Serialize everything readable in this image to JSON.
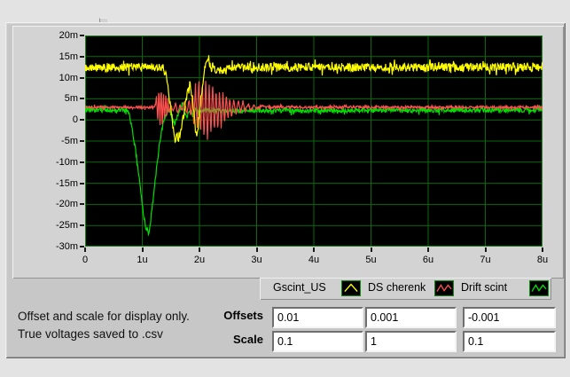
{
  "window": {
    "bg": "#e3e3e3",
    "panel_bg": "#c7c7c7",
    "graph_panel_bg": "#d3d3d3"
  },
  "info_text": {
    "line1": "Offset and scale for display only.",
    "line2": "True voltages saved to .csv"
  },
  "controls": {
    "offsets_label": "Offsets",
    "scale_label": "Scale",
    "offsets": [
      "0.01",
      "0.001",
      "-0.001"
    ],
    "scale": [
      "0.1",
      "1",
      "0.1"
    ]
  },
  "legend": {
    "items": [
      {
        "label": "Gscint_US",
        "color": "#ffff00",
        "glyph": "caret"
      },
      {
        "label": "DS cherenk",
        "color": "#ff5050",
        "glyph": "zigzag"
      },
      {
        "label": "Drift scint",
        "color": "#00e000",
        "glyph": "zigzag"
      }
    ]
  },
  "chart_data": {
    "type": "line",
    "title": "",
    "xlabel": "",
    "ylabel": "",
    "plot_bg": "#000000",
    "grid_color": "#0a6a0a",
    "border_color": "#0f8a0f",
    "grid": true,
    "legend_position": "bottom-right",
    "x_range_us": [
      0,
      8
    ],
    "y_range_mV": [
      -30,
      20
    ],
    "x_ticks": [
      "0",
      "1u",
      "2u",
      "3u",
      "4u",
      "5u",
      "6u",
      "7u",
      "8u"
    ],
    "y_ticks": [
      "20m",
      "15m",
      "10m",
      "5m",
      "0",
      "-5m",
      "-10m",
      "-15m",
      "-20m",
      "-25m",
      "-30m"
    ],
    "series": [
      {
        "name": "Gscint_US",
        "color": "#ffff00",
        "seed": 7,
        "noise_mV": 1.0,
        "keypoints_us_mV": [
          [
            0,
            12.5
          ],
          [
            1.35,
            12.5
          ],
          [
            1.42,
            11
          ],
          [
            1.5,
            3
          ],
          [
            1.55,
            -3
          ],
          [
            1.58,
            -5
          ],
          [
            1.61,
            -3.5
          ],
          [
            1.64,
            -4.8
          ],
          [
            1.68,
            -2
          ],
          [
            1.73,
            1.5
          ],
          [
            1.78,
            5.5
          ],
          [
            1.83,
            8.5
          ],
          [
            1.87,
            6
          ],
          [
            1.9,
            2
          ],
          [
            1.93,
            -2.5
          ],
          [
            1.96,
            -3.2
          ],
          [
            2.0,
            1.5
          ],
          [
            2.04,
            7
          ],
          [
            2.08,
            11
          ],
          [
            2.12,
            14.2
          ],
          [
            2.16,
            14.8
          ],
          [
            2.2,
            11.5
          ],
          [
            2.24,
            13
          ],
          [
            2.28,
            10.8
          ],
          [
            2.33,
            12.2
          ],
          [
            2.4,
            11.3
          ],
          [
            2.5,
            12.2
          ],
          [
            2.6,
            12.5
          ],
          [
            8,
            12.5
          ]
        ]
      },
      {
        "name": "DS cherenk",
        "color": "#ff5050",
        "seed": 101,
        "noise_mV": 0.3,
        "keypoints_us_mV": [
          [
            0,
            3
          ],
          [
            1.22,
            3
          ],
          [
            1.25,
            5.5
          ],
          [
            1.27,
            -0.5
          ],
          [
            1.29,
            7.5
          ],
          [
            1.31,
            -1
          ],
          [
            1.33,
            8
          ],
          [
            1.35,
            -1.5
          ],
          [
            1.37,
            7
          ],
          [
            1.39,
            -0.5
          ],
          [
            1.41,
            6
          ],
          [
            1.43,
            0.5
          ],
          [
            1.45,
            5
          ],
          [
            1.47,
            1.5
          ],
          [
            1.5,
            3.5
          ],
          [
            1.54,
            2
          ],
          [
            1.58,
            4
          ],
          [
            1.62,
            1.5
          ],
          [
            1.66,
            3.5
          ],
          [
            1.7,
            2
          ],
          [
            1.74,
            4.5
          ],
          [
            1.78,
            1.5
          ],
          [
            1.82,
            5
          ],
          [
            1.85,
            0.5
          ],
          [
            1.88,
            7
          ],
          [
            1.9,
            -1.5
          ],
          [
            1.93,
            8.5
          ],
          [
            1.96,
            -2.5
          ],
          [
            1.99,
            10.5
          ],
          [
            2.02,
            -3.5
          ],
          [
            2.05,
            9
          ],
          [
            2.08,
            -4.5
          ],
          [
            2.11,
            10
          ],
          [
            2.14,
            -5.2
          ],
          [
            2.17,
            8.5
          ],
          [
            2.2,
            -3.5
          ],
          [
            2.23,
            9
          ],
          [
            2.26,
            -3
          ],
          [
            2.29,
            7.5
          ],
          [
            2.32,
            -2.5
          ],
          [
            2.35,
            7
          ],
          [
            2.38,
            -2
          ],
          [
            2.41,
            6.5
          ],
          [
            2.44,
            -1
          ],
          [
            2.47,
            6
          ],
          [
            2.5,
            0
          ],
          [
            2.53,
            5.5
          ],
          [
            2.56,
            0.5
          ],
          [
            2.6,
            5
          ],
          [
            2.64,
            1
          ],
          [
            2.68,
            4.8
          ],
          [
            2.72,
            1.5
          ],
          [
            2.76,
            4.5
          ],
          [
            2.8,
            2
          ],
          [
            2.85,
            4
          ],
          [
            2.9,
            2.3
          ],
          [
            2.95,
            3.6
          ],
          [
            3.0,
            2.6
          ],
          [
            3.1,
            3.3
          ],
          [
            3.2,
            3
          ],
          [
            8,
            3
          ]
        ]
      },
      {
        "name": "Drift scint",
        "color": "#00e000",
        "seed": 55,
        "noise_mV": 0.55,
        "keypoints_us_mV": [
          [
            0,
            2.3
          ],
          [
            0.72,
            2.3
          ],
          [
            0.78,
            1
          ],
          [
            0.82,
            -2
          ],
          [
            0.88,
            -7
          ],
          [
            0.95,
            -14
          ],
          [
            1.0,
            -20
          ],
          [
            1.04,
            -24
          ],
          [
            1.07,
            -26
          ],
          [
            1.09,
            -25.3
          ],
          [
            1.11,
            -27
          ],
          [
            1.14,
            -24.5
          ],
          [
            1.18,
            -20
          ],
          [
            1.22,
            -15
          ],
          [
            1.27,
            -9
          ],
          [
            1.32,
            -4
          ],
          [
            1.37,
            -0.5
          ],
          [
            1.42,
            2
          ],
          [
            1.47,
            2.3
          ],
          [
            1.52,
            0.5
          ],
          [
            1.56,
            -1.5
          ],
          [
            1.6,
            0.5
          ],
          [
            1.65,
            2
          ],
          [
            1.7,
            3.8
          ],
          [
            1.74,
            2
          ],
          [
            1.78,
            0.8
          ],
          [
            1.83,
            2.5
          ],
          [
            1.88,
            1
          ],
          [
            1.93,
            2.6
          ],
          [
            2.0,
            1.8
          ],
          [
            2.1,
            2.5
          ],
          [
            2.3,
            2.2
          ],
          [
            8,
            2.35
          ]
        ]
      }
    ]
  }
}
